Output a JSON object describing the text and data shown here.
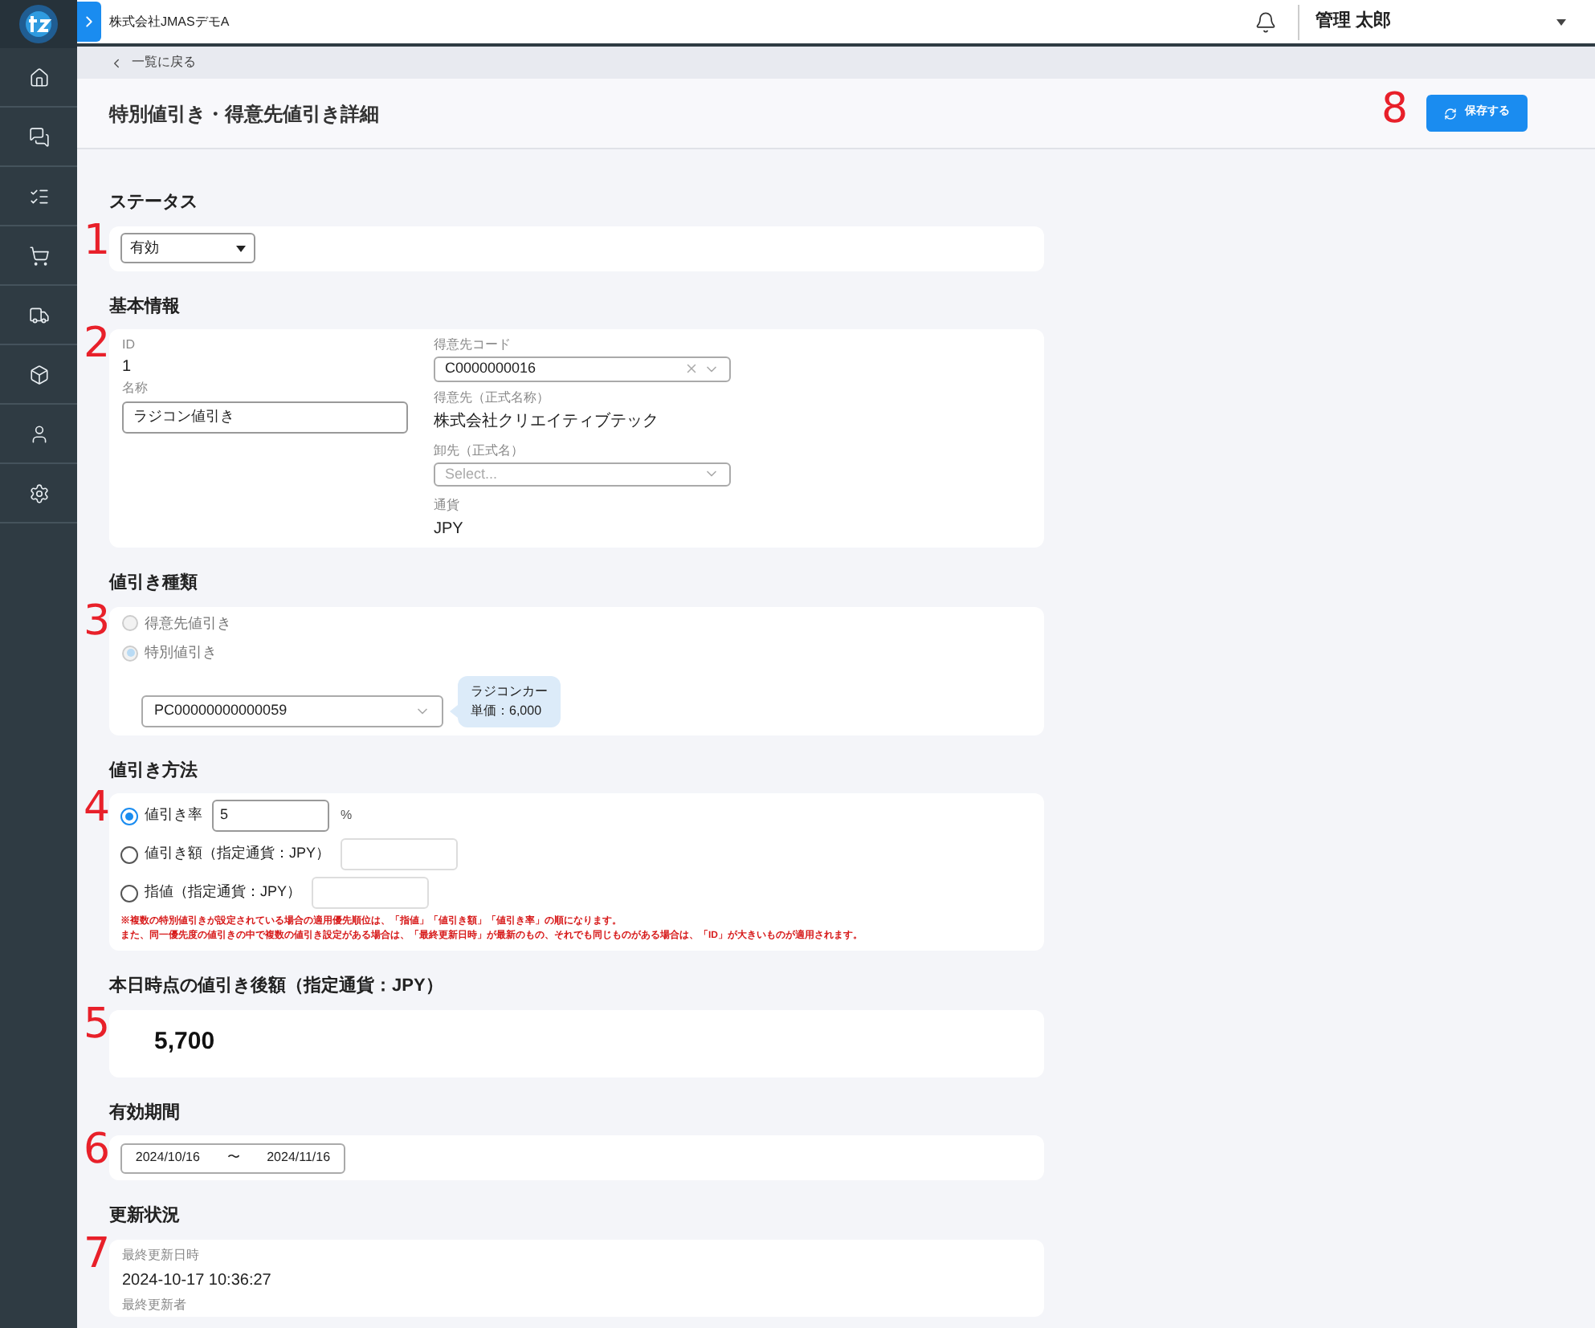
{
  "header": {
    "company": "株式会社JMASデモA",
    "user": "管理 太郎"
  },
  "breadcrumb": "一覧に戻る",
  "page_title": "特別値引き・得意先値引き詳細",
  "save_button": {
    "label": "保存する",
    "marker": "8"
  },
  "status": {
    "title": "ステータス",
    "marker": "1",
    "value": "有効"
  },
  "basic": {
    "title": "基本情報",
    "marker": "2",
    "id_label": "ID",
    "id_value": "1",
    "name_label": "名称",
    "name_value": "ラジコン値引き",
    "customer_code_label": "得意先コード",
    "customer_code": "C0000000016",
    "customer_name_label": "得意先（正式名称）",
    "customer_name": "株式会社クリエイティブテック",
    "wholesaler_label": "卸先（正式名）",
    "wholesaler_placeholder": "Select...",
    "currency_label": "通貨",
    "currency": "JPY"
  },
  "discount_type": {
    "title": "値引き種類",
    "marker": "3",
    "options": [
      {
        "label": "得意先値引き",
        "selected": false,
        "disabled": true
      },
      {
        "label": "特別値引き",
        "selected": true,
        "disabled": true
      }
    ],
    "product_code": "PC00000000000059",
    "tooltip_lines": [
      "ラジコンカー",
      "単価：6,000"
    ]
  },
  "discount_method": {
    "title": "値引き方法",
    "marker": "4",
    "options": [
      {
        "label": "値引き率",
        "selected": true,
        "value": "5",
        "unit": "%"
      },
      {
        "label": "値引き額（指定通貨：JPY）",
        "selected": false
      },
      {
        "label": "指値（指定通貨：JPY）",
        "selected": false
      }
    ],
    "notes": [
      "※複数の特別値引きが設定されている場合の適用優先順位は、「指値」「値引き額」「値引き率」の順になります。",
      "また、同一優先度の値引きの中で複数の値引き設定がある場合は、「最終更新日時」が最新のもの、それでも同じものがある場合は、「ID」が大きいものが適用されます。"
    ]
  },
  "discounted_price": {
    "title": "本日時点の値引き後額（指定通貨：JPY）",
    "marker": "5",
    "value": "5,700"
  },
  "period": {
    "title": "有効期間",
    "marker": "6",
    "start": "2024/10/16",
    "separator": "〜",
    "end": "2024/11/16"
  },
  "update_status": {
    "title": "更新状況",
    "marker": "7",
    "updated_at_label": "最終更新日時",
    "updated_at": "2024-10-17 10:36:27",
    "updated_by_label": "最終更新者"
  }
}
